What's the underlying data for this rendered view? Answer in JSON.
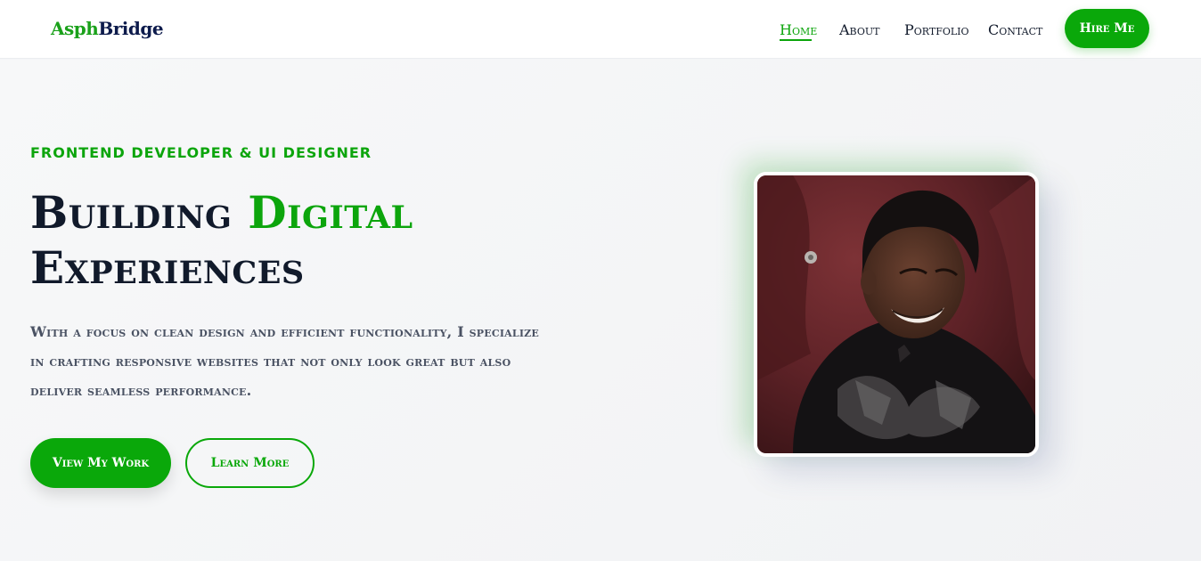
{
  "brand": {
    "part1": "Asph",
    "part2": "Bridge"
  },
  "nav": {
    "items": [
      {
        "label": "Home",
        "active": true
      },
      {
        "label": "About",
        "active": false
      },
      {
        "label": "Portfolio",
        "active": false
      },
      {
        "label": "Contact",
        "active": false
      }
    ],
    "cta_label": "Hire Me"
  },
  "hero": {
    "kicker": "FRONTEND DEVELOPER & UI DESIGNER",
    "headline_part1": "Building ",
    "headline_accent": "Digital",
    "headline_part2": "Experiences",
    "intro": "With a focus on clean design and efficient functionality, I specialize in crafting responsive websites that not only look great but also deliver seamless performance.",
    "primary_button": "View My Work",
    "secondary_button": "Learn More"
  },
  "portrait": {
    "icon": "profile-photo"
  },
  "colors": {
    "accent": "#0aa80a",
    "navy": "#0d1b4c",
    "headline": "#111a2b",
    "body_text": "#4a5263"
  }
}
